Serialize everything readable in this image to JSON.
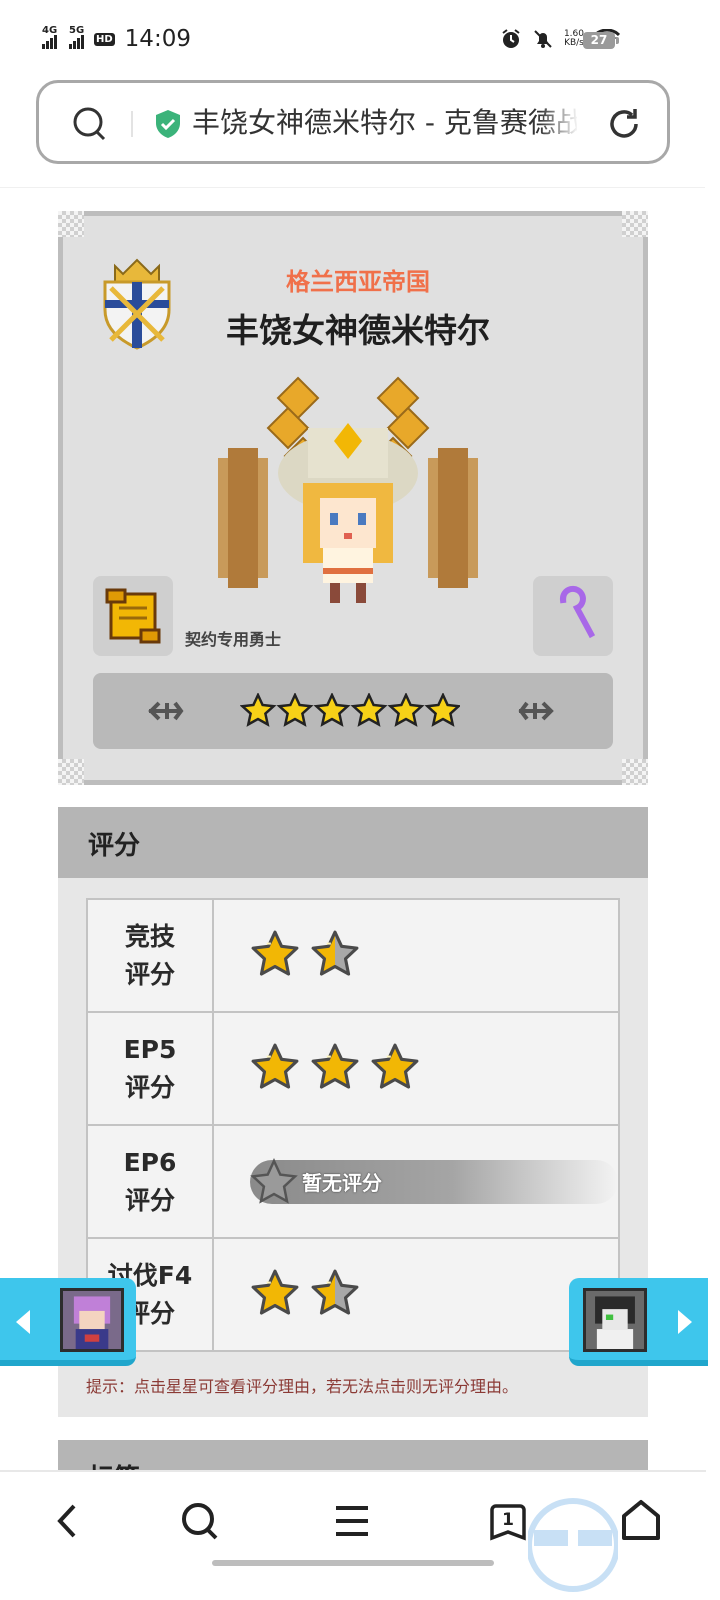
{
  "status_bar": {
    "net1": "4G",
    "net2": "5G",
    "hd": "HD",
    "time": "14:09",
    "speed_value": "1.60",
    "speed_unit": "KB/s",
    "battery": "27"
  },
  "address_bar": {
    "title": "丰饶女神德米特尔 - 克鲁赛德战记"
  },
  "hero": {
    "kingdom": "格兰西亚帝国",
    "name": "丰饶女神德米特尔",
    "contract": "契约专用勇士",
    "star_count": 6
  },
  "rating": {
    "title": "评分",
    "rows": [
      {
        "label_line1": "竞技",
        "label_line2": "评分",
        "stars": 1.5
      },
      {
        "label_line1": "EP5",
        "label_line2": "评分",
        "stars": 3
      },
      {
        "label_line1": "EP6",
        "label_line2": "评分",
        "stars": 0,
        "no_rating_text": "暂无评分"
      },
      {
        "label_line1": "讨伐F4",
        "label_line2": "评分",
        "stars": 1.5
      }
    ],
    "hint": "提示：点击星星可查看评分理由，若无法点击则无评分理由。"
  },
  "next_section": {
    "title": "标签"
  },
  "bottom_nav": {
    "tab_count": "1"
  },
  "colors": {
    "kingdom": "#f0704a",
    "float_nav": "#3ec6ec",
    "hint": "#8b3a35",
    "star_gold": "#f2b705"
  }
}
